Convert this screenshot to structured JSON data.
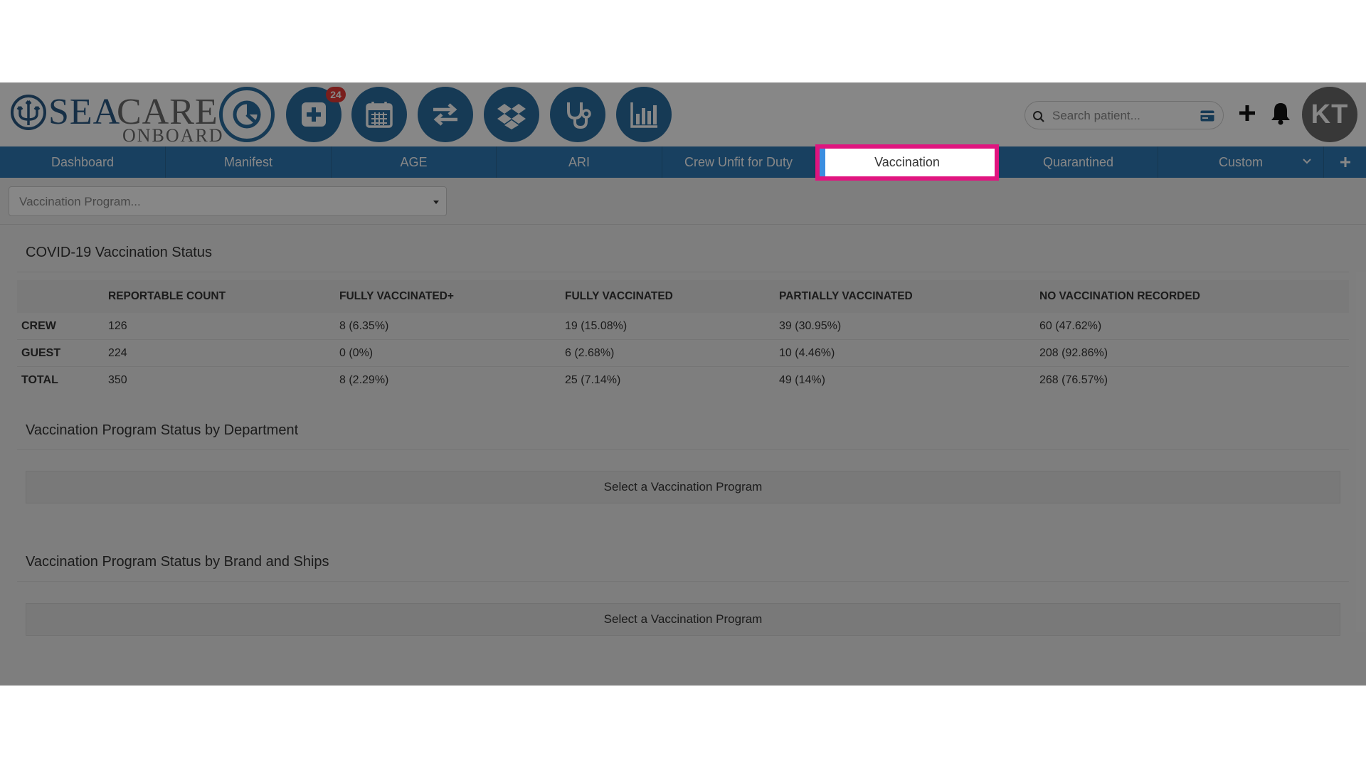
{
  "brand": {
    "sea": "SEA",
    "care": "CARE",
    "onboard": "ONBOARD"
  },
  "toolbar": {
    "buttons": [
      {
        "icon": "pie-chart-icon"
      },
      {
        "icon": "medical-plus-icon",
        "badge": "24"
      },
      {
        "icon": "calendar-icon"
      },
      {
        "icon": "transfer-arrows-icon"
      },
      {
        "icon": "dropbox-icon"
      },
      {
        "icon": "stethoscope-icon"
      },
      {
        "icon": "bar-chart-icon"
      }
    ],
    "search_placeholder": "Search patient...",
    "avatar_initials": "KT"
  },
  "tabs": [
    {
      "label": "Dashboard"
    },
    {
      "label": "Manifest"
    },
    {
      "label": "AGE"
    },
    {
      "label": "ARI"
    },
    {
      "label": "Crew Unfit for Duty"
    },
    {
      "label": "Vaccination",
      "active": true
    },
    {
      "label": "Quarantined"
    },
    {
      "label": "Custom"
    }
  ],
  "filter": {
    "program_placeholder": "Vaccination Program..."
  },
  "covid": {
    "title": "COVID-19 Vaccination Status",
    "columns": [
      "",
      "REPORTABLE COUNT",
      "FULLY VACCINATED+",
      "FULLY VACCINATED",
      "PARTIALLY VACCINATED",
      "NO VACCINATION RECORDED"
    ],
    "rows": [
      {
        "label": "CREW",
        "count": "126",
        "fully_plus": "8 (6.35%)",
        "fully": "19 (15.08%)",
        "partial": "39 (30.95%)",
        "none": "60 (47.62%)"
      },
      {
        "label": "GUEST",
        "count": "224",
        "fully_plus": "0 (0%)",
        "fully": "6 (2.68%)",
        "partial": "10 (4.46%)",
        "none": "208 (92.86%)"
      },
      {
        "label": "TOTAL",
        "count": "350",
        "fully_plus": "8 (2.29%)",
        "fully": "25 (7.14%)",
        "partial": "49 (14%)",
        "none": "268 (76.57%)"
      }
    ]
  },
  "by_department": {
    "title": "Vaccination Program Status by Department",
    "empty": "Select a Vaccination Program"
  },
  "by_brand": {
    "title": "Vaccination Program Status by Brand and Ships",
    "empty": "Select a Vaccination Program"
  },
  "colors": {
    "brand_blue": "#2b6ea0",
    "tab_blue": "#2e79b5",
    "highlight": "#e0157f",
    "badge_red": "#e53935"
  }
}
